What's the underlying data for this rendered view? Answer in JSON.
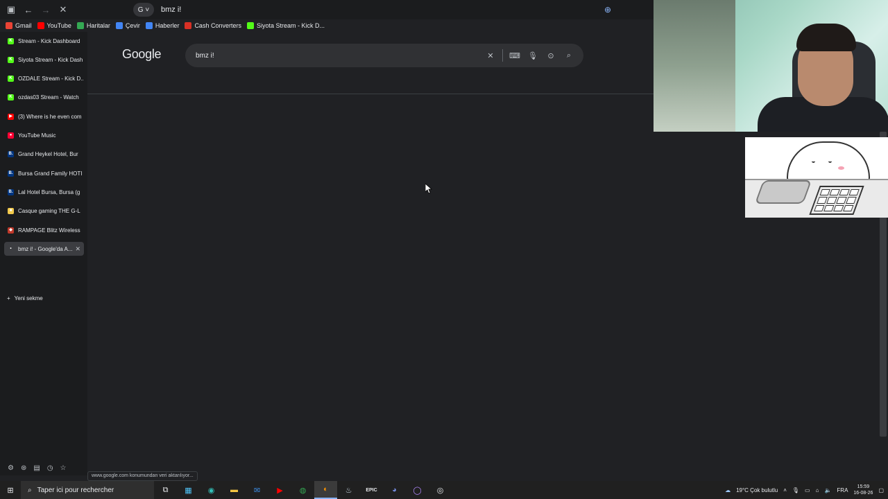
{
  "browser": {
    "address": "bmz i!",
    "bookmarks": [
      {
        "label": "Gmail",
        "icon": "gmail-icon",
        "color": "#ea4335"
      },
      {
        "label": "YouTube",
        "icon": "youtube-icon",
        "color": "#ff0000"
      },
      {
        "label": "Haritalar",
        "icon": "maps-icon",
        "color": "#34a853"
      },
      {
        "label": "Çevir",
        "icon": "translate-icon",
        "color": "#4285f4"
      },
      {
        "label": "Haberler",
        "icon": "news-icon",
        "color": "#4285f4"
      },
      {
        "label": "Cash Converters",
        "icon": "cash-converters-icon",
        "color": "#d93025"
      },
      {
        "label": "Siyota Stream - Kick D...",
        "icon": "kick-icon",
        "color": "#53fc18"
      }
    ]
  },
  "sidebar": {
    "tabs": [
      {
        "label": "Stream - Kick Dashboard",
        "icon": "kick-icon",
        "color": "#53fc18",
        "glyph": "K"
      },
      {
        "label": "Siyota Stream - Kick Dash",
        "icon": "kick-icon",
        "color": "#53fc18",
        "glyph": "K"
      },
      {
        "label": "OZDALE Stream - Kick D...",
        "icon": "kick-icon",
        "color": "#53fc18",
        "glyph": "K"
      },
      {
        "label": "ozdas03 Stream - Watch",
        "icon": "kick-icon",
        "color": "#53fc18",
        "glyph": "K"
      },
      {
        "label": "(3) Where is he even com",
        "icon": "youtube-icon",
        "color": "#ff0000",
        "glyph": "▶"
      },
      {
        "label": "YouTube Music",
        "icon": "youtube-music-icon",
        "color": "#ff0033",
        "glyph": "●"
      },
      {
        "label": "Grand Heykel Hotel, Bur",
        "icon": "booking-icon",
        "color": "#003580",
        "glyph": "B."
      },
      {
        "label": "Bursa Grand Family HOTI",
        "icon": "booking-icon",
        "color": "#003580",
        "glyph": "B."
      },
      {
        "label": "Lal Hotel Bursa, Bursa (g",
        "icon": "booking-icon",
        "color": "#003580",
        "glyph": "B."
      },
      {
        "label": "Casque gaming THE G-L",
        "icon": "shop-icon",
        "color": "#f2c94c",
        "glyph": "■"
      },
      {
        "label": "RAMPAGE Blitz Wireless",
        "icon": "rampage-icon",
        "color": "#c0392b",
        "glyph": "◆"
      },
      {
        "label": "bmz i! - Google'da A...",
        "icon": "google-icon",
        "color": "#5f6368",
        "glyph": "•",
        "active": true
      }
    ],
    "new_tab_label": "Yeni sekme"
  },
  "page": {
    "logo": "Google",
    "query": "bmz i!"
  },
  "status_text": "www.google.com konumundan veri aktarılıyor...",
  "taskbar": {
    "search_placeholder": "Taper ici pour rechercher",
    "weather": "19°C  Çok bulutlu",
    "language": "FRA",
    "time": "15:59",
    "date": "16-08-26"
  }
}
